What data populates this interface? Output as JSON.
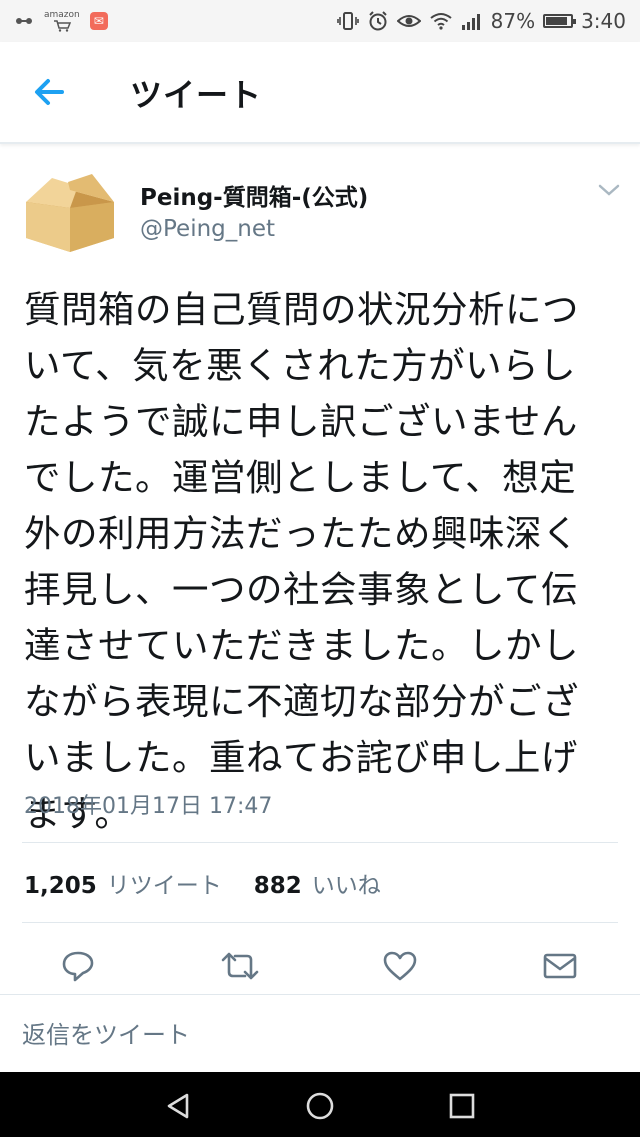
{
  "status_bar": {
    "amazon_label": "amazon",
    "battery_percent": "87%",
    "battery_level": 0.87,
    "time": "3:40"
  },
  "header": {
    "title": "ツイート"
  },
  "tweet": {
    "author_name": "Peing-質問箱-(公式)",
    "author_handle": "@Peing_net",
    "text": "質問箱の自己質問の状況分析につ\nいて、気を悪くされた方がいらし\nたようで誠に申し訳ございません\nでした。運営側としまして、想定\n外の利用方法だったため興味深く\n拝見し、一つの社会事象として伝\n達させていただきました。しかし\nながら表現に不適切な部分がござ\nいました。重ねてお詫び申し上げ\nます。",
    "timestamp": "2018年01月17日 17:47",
    "retweet_count": "1,205",
    "retweet_label": "リツイート",
    "like_count": "882",
    "like_label": "いいね"
  },
  "reply": {
    "placeholder": "返信をツイート"
  },
  "colors": {
    "accent": "#1da1f2",
    "secondary_text": "#657786",
    "icon_gray": "#657786"
  }
}
